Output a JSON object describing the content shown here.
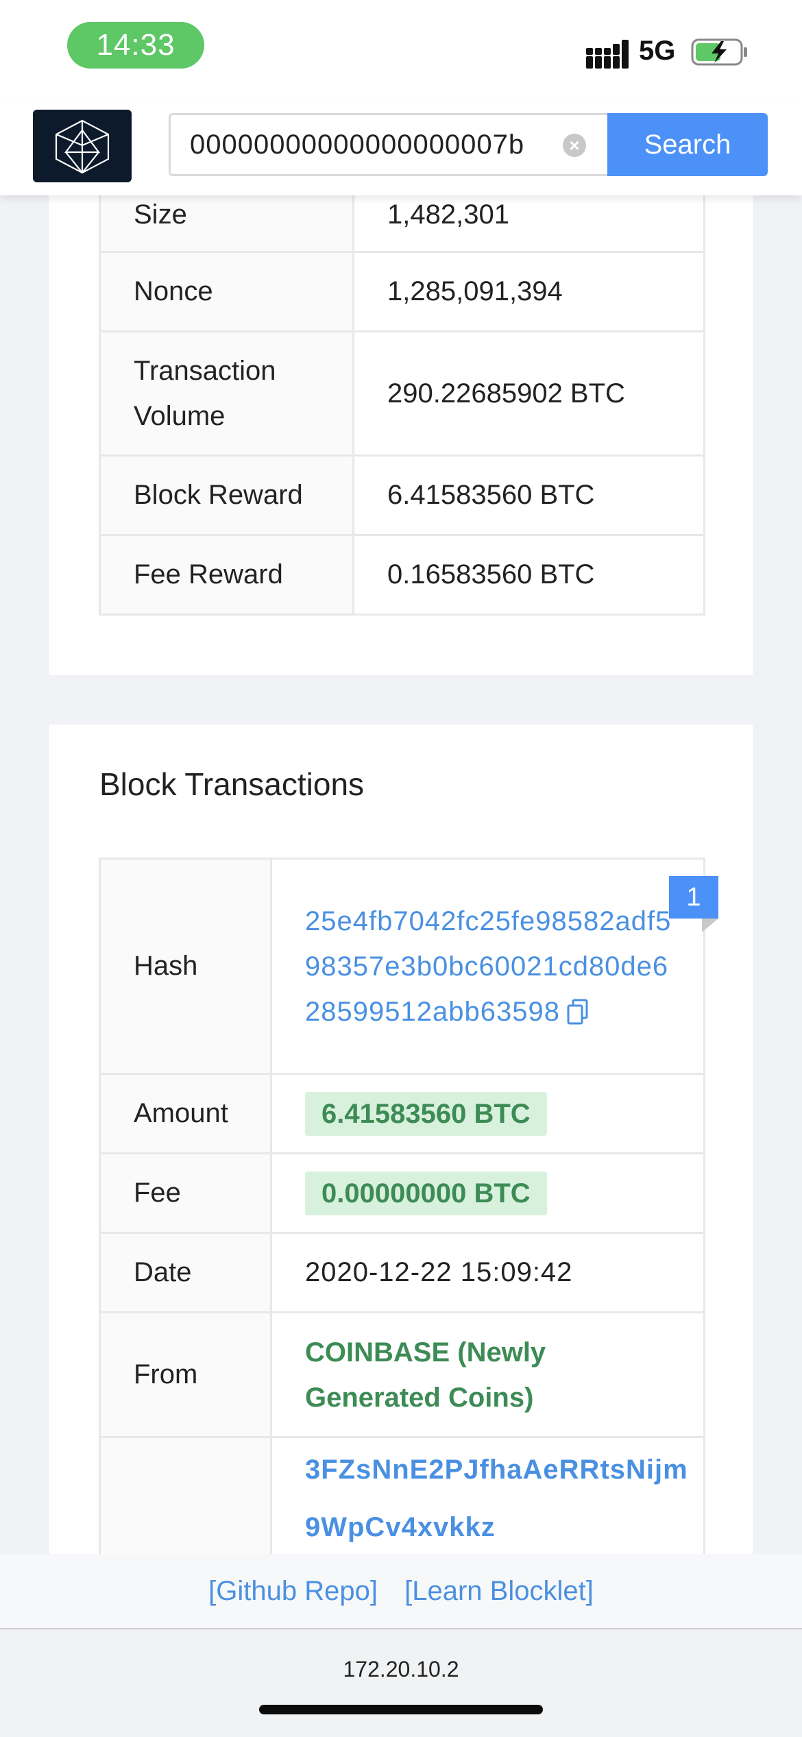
{
  "status_bar": {
    "time": "14:33",
    "network": "5G"
  },
  "header": {
    "search_value": "00000000000000000007b",
    "search_button": "Search"
  },
  "block_details": {
    "rows": [
      {
        "label": "Size",
        "value": "1,482,301"
      },
      {
        "label": "Nonce",
        "value": "1,285,091,394"
      },
      {
        "label": "Transaction Volume",
        "value": "290.22685902 BTC"
      },
      {
        "label": "Block Reward",
        "value": "6.41583560 BTC"
      },
      {
        "label": "Fee Reward",
        "value": "0.16583560 BTC"
      }
    ]
  },
  "transactions": {
    "title": "Block Transactions",
    "index_badge": "1",
    "hash_label": "Hash",
    "hash": "25e4fb7042fc25fe98582adf598357e3b0bc60021cd80de628599512abb63598",
    "amount_label": "Amount",
    "amount": "6.41583560 BTC",
    "fee_label": "Fee",
    "fee": "0.00000000 BTC",
    "date_label": "Date",
    "date": "2020-12-22 15:09:42",
    "from_label": "From",
    "from": "COINBASE (Newly Generated Coins)",
    "to_address": "3FZsNnE2PJfhaAeRRtsNijm9WpCv4xvkkz"
  },
  "footer": {
    "links": [
      "[Github Repo]",
      "[Learn Blocklet]"
    ],
    "url": "172.20.10.2"
  },
  "colors": {
    "accent": "#4c91f7",
    "link": "#4a90e2",
    "success_bg": "#d8f1dd",
    "success_text": "#3d8b55",
    "status_pill": "#5ec766",
    "logo_bg": "#0d1a2b"
  }
}
